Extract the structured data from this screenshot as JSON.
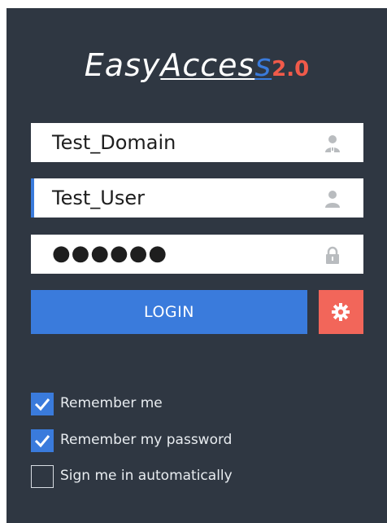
{
  "logo": {
    "part1": "Easy",
    "part2": "Acces",
    "part3": "s",
    "version": "2.0"
  },
  "fields": {
    "domain": {
      "value": "Test_Domain",
      "icon": "domain-user-icon"
    },
    "user": {
      "value": "Test_User",
      "icon": "user-icon"
    },
    "password": {
      "value": "●●●●●●",
      "icon": "lock-icon"
    }
  },
  "login": {
    "label": "LOGIN"
  },
  "settings": {
    "icon": "gear-icon"
  },
  "options": [
    {
      "label": "Remember me",
      "checked": true
    },
    {
      "label": "Remember my password",
      "checked": true
    },
    {
      "label": "Sign me in automatically",
      "checked": false
    }
  ],
  "colors": {
    "background": "#2f3742",
    "accent": "#3a7bdc",
    "settings_button": "#f2665a",
    "version": "#f05a4a"
  }
}
